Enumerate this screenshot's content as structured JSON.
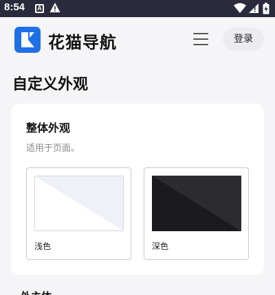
{
  "status_bar": {
    "time": "8:54",
    "notification_icon_letter": "A",
    "icons": [
      "a-notification-icon",
      "warning-icon",
      "wifi-icon",
      "cellular-signal-icon",
      "battery-icon"
    ],
    "background": "#2a2a3c"
  },
  "header": {
    "brand": "花猫导航",
    "logo_color": "#1f6fe5",
    "menu_icon": "hamburger-menu-icon",
    "login_label": "登录"
  },
  "page": {
    "title": "自定义外观"
  },
  "appearance_card": {
    "title": "整体外观",
    "description": "适用于页面。",
    "options": [
      {
        "id": "light",
        "label": "浅色",
        "colors": [
          "#ffffff",
          "#eef1f7"
        ]
      },
      {
        "id": "dark",
        "label": "深色",
        "colors": [
          "#1b1b1d",
          "#2c2c2e"
        ]
      }
    ]
  },
  "next_section": {
    "title": "外主体"
  }
}
